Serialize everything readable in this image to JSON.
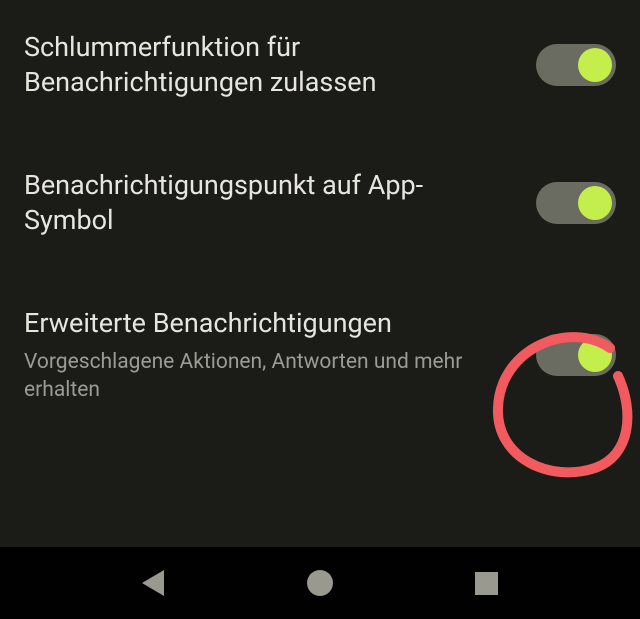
{
  "settings": [
    {
      "title": "Schlummerfunktion für Benachrichtigungen zulassen",
      "subtitle": "",
      "enabled": true
    },
    {
      "title": "Benachrichtigungspunkt auf App-Symbol",
      "subtitle": "",
      "enabled": true
    },
    {
      "title": "Erweiterte Benachrichtigungen",
      "subtitle": "Vorgeschlagene Aktionen, Antworten und mehr erhalten",
      "enabled": true
    }
  ],
  "annotation": {
    "color": "#f15a5e",
    "targets_setting_index": 2
  },
  "nav": {
    "back": "back",
    "home": "home",
    "recent": "recent"
  }
}
